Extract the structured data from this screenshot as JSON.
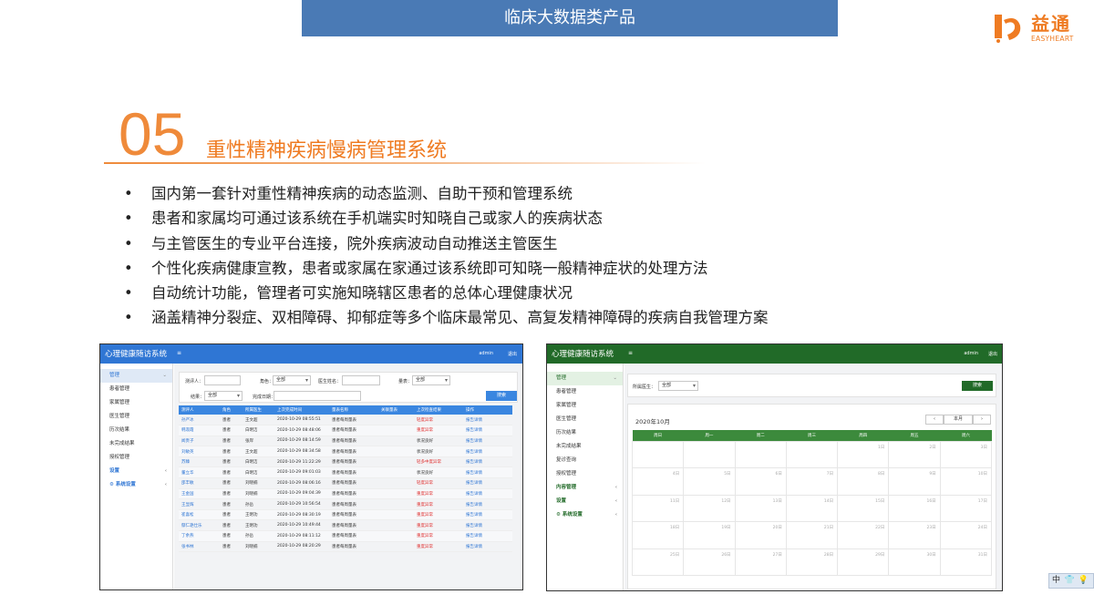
{
  "banner": {
    "title": "临床大数据类产品"
  },
  "logo": {
    "cn": "益通",
    "en": "EASYHEART",
    "color": "#ef7b22"
  },
  "section": {
    "number": "05",
    "title": "重性精神疾病慢病管理系统"
  },
  "bullets": [
    "国内第一套针对重性精神疾病的动态监测、自助干预和管理系统",
    "患者和家属均可通过该系统在手机端实时知晓自己或家人的疾病状态",
    "与主管医生的专业平台连接，院外疾病波动自动推送主管医生",
    "个性化疾病健康宣教，患者或家属在家通过该系统即可知晓一般精神症状的处理方法",
    "自动统计功能，管理者可实施知晓辖区患者的总体心理健康状况",
    "涵盖精神分裂症、双相障碍、抑郁症等多个临床最常见、高复发精神障碍的疾病自我管理方案"
  ],
  "shot1": {
    "accent": "#2f76d4",
    "app_title": "心理健康随访系统",
    "menu_icon": "≡",
    "user": "admin",
    "logout": "退出",
    "sidebar": [
      {
        "label": "管理",
        "type": "active",
        "chev": "⌄"
      },
      {
        "label": "患者管理",
        "type": "item",
        "chev": ""
      },
      {
        "label": "家属管理",
        "type": "item",
        "chev": ""
      },
      {
        "label": "医生管理",
        "type": "item",
        "chev": ""
      },
      {
        "label": "历次结果",
        "type": "item",
        "chev": ""
      },
      {
        "label": "未完成结果",
        "type": "item",
        "chev": ""
      },
      {
        "label": "授权管理",
        "type": "item",
        "chev": ""
      },
      {
        "label": "设置",
        "type": "grp",
        "chev": "‹"
      },
      {
        "label": "⚙ 系统设置",
        "type": "grp",
        "chev": "‹"
      }
    ],
    "filters": {
      "tester_label": "测评人：",
      "role_label": "角色：",
      "role_value": "全部",
      "doctor_label": "医生姓名：",
      "scale_label": "量表：",
      "scale_value": "全部",
      "result_label": "结果：",
      "result_value": "全部",
      "date_label": "完成日期：",
      "search": "搜索"
    },
    "table": {
      "headers": [
        "测评人",
        "角色",
        "所属医生",
        "上次完成时间",
        "量表名称",
        "关联量表",
        "上次检查结果",
        "操作"
      ],
      "rows": [
        [
          "孙严冰",
          "患者",
          "王文超",
          "2020-10-29 08:55:51",
          "患者每周量表",
          "",
          "轻度异常",
          "报告详情"
        ],
        [
          "韩淑霞",
          "患者",
          "白明洁",
          "2020-10-29 08:48:06",
          "患者每周量表",
          "",
          "重度异常",
          "报告详情"
        ],
        [
          "闻贵子",
          "患者",
          "张岸",
          "2020-10-29 08:14:59",
          "患者每周量表",
          "",
          "状况良好",
          "报告详情"
        ],
        [
          "刘敏英",
          "患者",
          "王文超",
          "2020-10-29 08:34:58",
          "患者每周量表",
          "",
          "状况良好",
          "报告详情"
        ],
        [
          "苏臻",
          "患者",
          "白明洁",
          "2020-10-29 11:22:29",
          "患者每周量表",
          "",
          "轻多中度异常",
          "报告详情"
        ],
        [
          "董立华",
          "患者",
          "白明洁",
          "2020-10-29 09:01:03",
          "患者每周量表",
          "",
          "状况良好",
          "报告详情"
        ],
        [
          "邵丰敏",
          "患者",
          "刘晓楠",
          "2020-10-29 08:06:16",
          "患者每周量表",
          "",
          "轻度异常",
          "报告详情"
        ],
        [
          "王金国",
          "患者",
          "刘晓楠",
          "2020-10-29 09:04:39",
          "患者每周量表",
          "",
          "重度异常",
          "报告详情"
        ],
        [
          "王显辉",
          "患者",
          "孙岳",
          "2020-10-29 10:56:54",
          "患者每周量表",
          "",
          "重度异常",
          "报告详情"
        ],
        [
          "崔喜松",
          "患者",
          "王明功",
          "2020-10-29 08:30:19",
          "患者每周量表",
          "",
          "重度异常",
          "报告详情"
        ],
        [
          "鄢仁艳仕乐",
          "患者",
          "王明功",
          "2020-10-29 10:49:44",
          "患者每周量表",
          "",
          "重度异常",
          "报告详情"
        ],
        [
          "丁余燕",
          "患者",
          "孙岳",
          "2020-10-29 08:11:12",
          "患者每周量表",
          "",
          "重度异常",
          "报告详情"
        ],
        [
          "张书林",
          "患者",
          "刘晓楠",
          "2020-10-29 08:20:29",
          "患者每周量表",
          "",
          "重度异常",
          "报告详情"
        ]
      ]
    }
  },
  "shot2": {
    "accent": "#216a28",
    "app_title": "心理健康随访系统",
    "menu_icon": "≡",
    "user": "admin",
    "logout": "退出",
    "sidebar": [
      {
        "label": "管理",
        "type": "active",
        "chev": "⌄"
      },
      {
        "label": "患者管理",
        "type": "item",
        "chev": ""
      },
      {
        "label": "家属管理",
        "type": "item",
        "chev": ""
      },
      {
        "label": "医生管理",
        "type": "item",
        "chev": ""
      },
      {
        "label": "历次结果",
        "type": "item",
        "chev": ""
      },
      {
        "label": "未完成结果",
        "type": "item",
        "chev": ""
      },
      {
        "label": "复诊查询",
        "type": "item",
        "chev": ""
      },
      {
        "label": "授权管理",
        "type": "item",
        "chev": ""
      },
      {
        "label": "内容管理",
        "type": "grp",
        "chev": "‹"
      },
      {
        "label": "设置",
        "type": "grp",
        "chev": "‹"
      },
      {
        "label": "⚙ 系统设置",
        "type": "grp",
        "chev": "‹"
      }
    ],
    "filter": {
      "doctor_label": "所属医生：",
      "doctor_value": "全部",
      "search": "搜索"
    },
    "calendar": {
      "month_title": "2020年10月",
      "prev": "‹",
      "today": "本月",
      "next": "›",
      "weekdays": [
        "周日",
        "周一",
        "周二",
        "周三",
        "周四",
        "周五",
        "周六"
      ],
      "weeks": [
        [
          "",
          "",
          "",
          "",
          "1日",
          "2日",
          "3日"
        ],
        [
          "4日",
          "5日",
          "6日",
          "7日",
          "8日",
          "9日",
          "10日"
        ],
        [
          "11日",
          "12日",
          "13日",
          "14日",
          "15日",
          "16日",
          "17日"
        ],
        [
          "18日",
          "19日",
          "20日",
          "21日",
          "22日",
          "23日",
          "24日"
        ],
        [
          "25日",
          "26日",
          "27日",
          "28日",
          "29日",
          "30日",
          "31日"
        ]
      ]
    }
  },
  "ime": {
    "items": [
      "中",
      "👕",
      "💡"
    ]
  }
}
